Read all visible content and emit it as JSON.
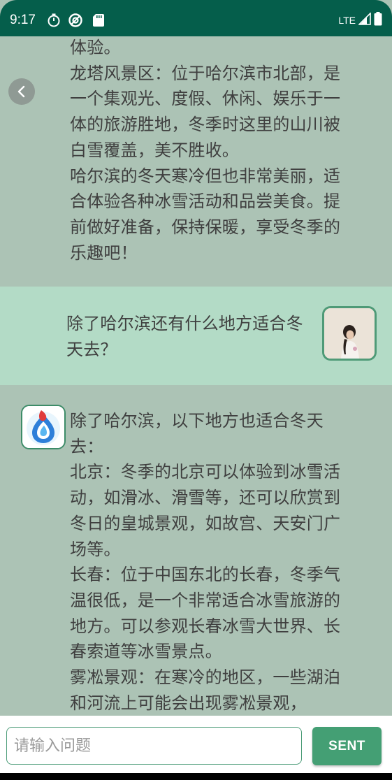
{
  "status_bar": {
    "time": "9:17",
    "network": "LTE",
    "icons": [
      "timer-icon",
      "vpn-icon",
      "sd-card-icon",
      "signal-icon",
      "battery-icon"
    ],
    "background": "#055e4b"
  },
  "messages": [
    {
      "role": "assistant",
      "text": "体验。\n龙塔风景区：位于哈尔滨市北部，是一个集观光、度假、休闲、娱乐于一体的旅游胜地，冬季时这里的山川被白雪覆盖，美不胜收。\n哈尔滨的冬天寒冷但也非常美丽，适合体验各种冰雪活动和品尝美食。提前做好准备，保持保暖，享受冬季的乐趣吧！",
      "background": "#acc3b5"
    },
    {
      "role": "user",
      "text": "除了哈尔滨还有什么地方适合冬天去？",
      "background": "#b3dbc6"
    },
    {
      "role": "assistant",
      "text": "除了哈尔滨，以下地方也适合冬天去：\n北京：冬季的北京可以体验到冰雪活动，如滑冰、滑雪等，还可以欣赏到冬日的皇城景观，如故宫、天安门广场等。\n长春：位于中国东北的长春，冬季气温很低，是一个非常适合冰雪旅游的地方。可以参观长春冰雪大世界、长春索道等冰雪景点。\n雾凇景观：在寒冷的地区，一些湖泊和河流上可能会出现雾凇景观，",
      "background": "#acc3b5"
    }
  ],
  "input": {
    "placeholder": "请输入问题",
    "value": ""
  },
  "send_button": {
    "label": "SENT",
    "color": "#449f74"
  },
  "colors": {
    "accent": "#449f74",
    "border": "#4c9c78",
    "text": "#3f3f3f"
  }
}
